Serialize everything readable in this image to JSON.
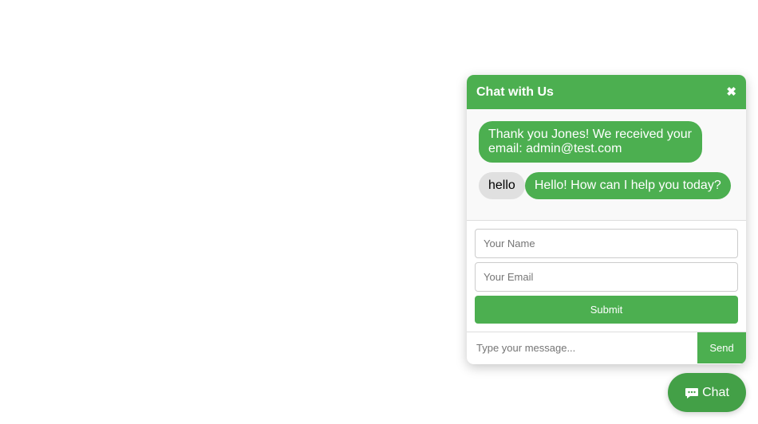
{
  "chat": {
    "title": "Chat with Us",
    "close_icon": "close-icon",
    "messages": [
      {
        "from": "bot",
        "text": "Thank you Jones! We received your email: admin@test.com"
      },
      {
        "from": "user",
        "text": "hello"
      },
      {
        "from": "bot",
        "text": "Hello! How can I help you today?"
      }
    ],
    "form": {
      "name_placeholder": "Your Name",
      "email_placeholder": "Your Email",
      "submit_label": "Submit"
    },
    "input": {
      "placeholder": "Type your message...",
      "send_label": "Send"
    }
  },
  "launcher": {
    "icon": "speech-bubble-icon",
    "label": "Chat"
  },
  "colors": {
    "accent": "#4caf50",
    "user_bubble": "#e0e0e0"
  }
}
